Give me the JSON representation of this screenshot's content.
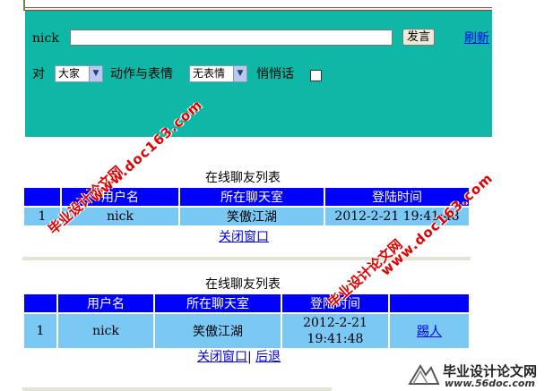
{
  "chat_form": {
    "nick_label": "nick",
    "send_button": "发言",
    "refresh_link": "刷新",
    "to_label": "对",
    "to_select": "大家",
    "action_label": "动作与表情",
    "action_select": "无表情",
    "whisper_label": "悄悄话"
  },
  "list1": {
    "title": "在线聊友列表",
    "headers": [
      "用户名",
      "所在聊天室",
      "登陆时间"
    ],
    "rows": [
      {
        "index": "1",
        "user": "nick",
        "room": "笑傲江湖",
        "time": "2012-2-21 19:41:48"
      }
    ],
    "close_link": "关闭窗口"
  },
  "list2": {
    "title": "在线聊友列表",
    "headers": [
      "用户名",
      "所在聊天室",
      "登陆时间"
    ],
    "rows": [
      {
        "index": "1",
        "user": "nick",
        "room": "笑傲江湖",
        "time_line1": "2012-2-21",
        "time_line2": "19:41:48",
        "action": "踢人"
      }
    ],
    "close_link": "关闭窗口",
    "separator": "|",
    "back_link": "后退"
  },
  "watermarks": {
    "site_cn": "毕业设计论文网",
    "site_url": "www.doc163.com",
    "logo_cn": "毕业设计论文网",
    "logo_url": "www.56doc.com"
  },
  "colors": {
    "panel": "#0fb8a6",
    "table_header": "#0000ff",
    "table_cell": "#7ac8f4",
    "watermark": "#e00000"
  }
}
